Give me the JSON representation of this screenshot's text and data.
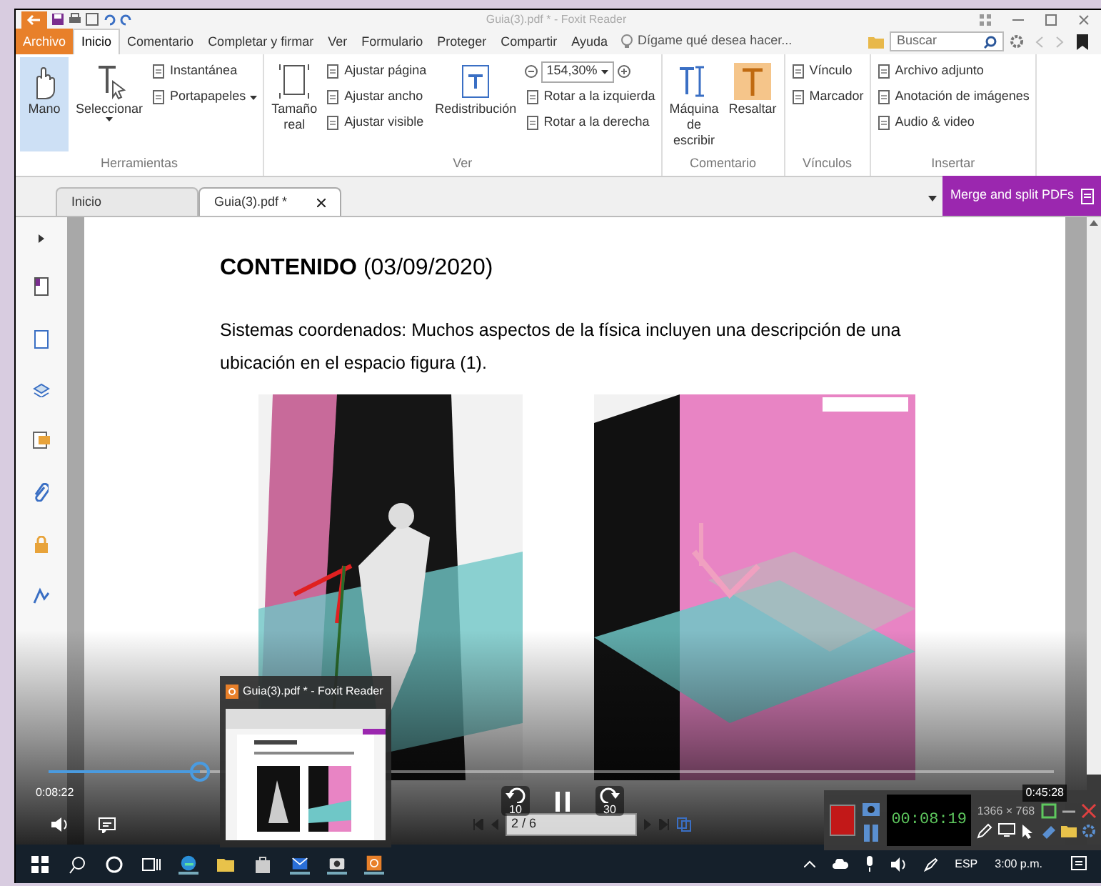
{
  "title_bar": {
    "title": "Guia(3).pdf * - Foxit Reader"
  },
  "menu_tabs": [
    {
      "label": "Archivo",
      "kind": "file",
      "selected": false
    },
    {
      "label": "Inicio",
      "kind": "tab",
      "selected": true
    },
    {
      "label": "Comentario",
      "kind": "tab",
      "selected": false
    },
    {
      "label": "Completar y firmar",
      "kind": "tab",
      "selected": false
    },
    {
      "label": "Ver",
      "kind": "tab",
      "selected": false
    },
    {
      "label": "Formulario",
      "kind": "tab",
      "selected": false
    },
    {
      "label": "Proteger",
      "kind": "tab",
      "selected": false
    },
    {
      "label": "Compartir",
      "kind": "tab",
      "selected": false
    },
    {
      "label": "Ayuda",
      "kind": "tab",
      "selected": false
    }
  ],
  "tell_me": {
    "placeholder": "Dígame qué desea hacer..."
  },
  "search": {
    "placeholder": "Buscar"
  },
  "ribbon": [
    {
      "label": "Herramientas",
      "items": [
        {
          "kind": "large",
          "label": "Mano",
          "selected": true,
          "dropdown": false
        },
        {
          "kind": "large",
          "label": "Seleccionar",
          "selected": false,
          "dropdown": true
        },
        {
          "kind": "small",
          "label": "Instantánea",
          "selected": false,
          "dropdown": false
        },
        {
          "kind": "small",
          "label": "Portapapeles",
          "selected": false,
          "dropdown": true
        }
      ]
    },
    {
      "label": "Ver",
      "items": [
        {
          "kind": "large",
          "label": "Tamaño real",
          "selected": false,
          "dropdown": false
        },
        {
          "kind": "small",
          "label": "Ajustar página",
          "selected": false,
          "dropdown": false
        },
        {
          "kind": "small",
          "label": "Ajustar ancho",
          "selected": false,
          "dropdown": false
        },
        {
          "kind": "small",
          "label": "Ajustar visible",
          "selected": false,
          "dropdown": false
        },
        {
          "kind": "large",
          "label": "Redistribución",
          "selected": false,
          "dropdown": false
        },
        {
          "kind": "zoom",
          "label": "154,30%",
          "selected": false,
          "dropdown": true
        },
        {
          "kind": "small",
          "label": "Rotar a la izquierda",
          "selected": false,
          "dropdown": false
        },
        {
          "kind": "small",
          "label": "Rotar a la derecha",
          "selected": false,
          "dropdown": false
        }
      ]
    },
    {
      "label": "Comentario",
      "items": [
        {
          "kind": "large",
          "label": "Máquina de escribir",
          "selected": false,
          "dropdown": false
        },
        {
          "kind": "large",
          "label": "Resaltar",
          "selected": false,
          "dropdown": false
        }
      ]
    },
    {
      "label": "Vínculos",
      "items": [
        {
          "kind": "small",
          "label": "Vínculo",
          "selected": false,
          "dropdown": false
        },
        {
          "kind": "small",
          "label": "Marcador",
          "selected": false,
          "dropdown": false
        }
      ]
    },
    {
      "label": "Insertar",
      "items": [
        {
          "kind": "small",
          "label": "Archivo adjunto",
          "selected": false,
          "dropdown": false
        },
        {
          "kind": "small",
          "label": "Anotación de imágenes",
          "selected": false,
          "dropdown": false
        },
        {
          "kind": "small",
          "label": "Audio & video",
          "selected": false,
          "dropdown": false
        }
      ]
    }
  ],
  "doc_tabs": [
    {
      "label": "Inicio",
      "selected": false,
      "closable": false
    },
    {
      "label": "Guia(3).pdf *",
      "selected": true,
      "closable": true
    }
  ],
  "merge_button": {
    "label": "Merge and split PDFs"
  },
  "document": {
    "heading": "**CONTENIDO** (03/09/2020)",
    "paragraph": "Sistemas coordenados: Muchos aspectos de la física incluyen una descripción de una ubicación en el espacio figura  (1)."
  },
  "player": {
    "elapsed": "0:08:22",
    "total": "0:45:28",
    "level": 0.15,
    "page": "2 / 6",
    "back": "10",
    "forward": "30"
  },
  "taskbar_preview": {
    "title": "Guia(3).pdf * - Foxit Reader"
  },
  "recorder": {
    "timer": "00:08:19",
    "resolution": "1366 × 768"
  },
  "taskbar": {
    "language": "ESP",
    "time": "3:00 p.m."
  }
}
